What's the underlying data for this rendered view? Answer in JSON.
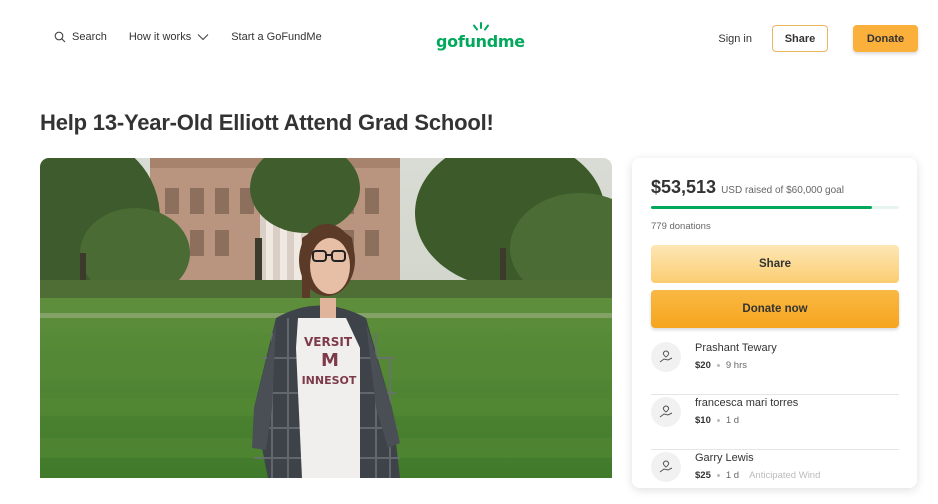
{
  "header": {
    "search_label": "Search",
    "how_it_works_label": "How it works",
    "start_label": "Start a GoFundMe",
    "logo_text": "gofundme",
    "signin_label": "Sign in",
    "share_label": "Share",
    "donate_label": "Donate"
  },
  "campaign": {
    "title": "Help 13-Year-Old Elliott Attend Grad School!"
  },
  "card": {
    "amount_raised": "$53,513",
    "raised_sub": "USD raised of $60,000 goal",
    "progress_fraction": 0.892,
    "donations_count": "779 donations",
    "share_label": "Share",
    "donate_label": "Donate now"
  },
  "donors": [
    {
      "name": "Prashant Tewary",
      "amount": "$20",
      "time": "9 hrs",
      "badge": ""
    },
    {
      "name": "francesca mari torres",
      "amount": "$10",
      "time": "1 d",
      "badge": ""
    },
    {
      "name": "Garry Lewis",
      "amount": "$25",
      "time": "1 d",
      "badge": "Anticipated Wind"
    }
  ],
  "colors": {
    "brand_green": "#02a95c",
    "donate_orange": "#fbb03b",
    "share_light": "#fde7b5"
  },
  "icons": {
    "search": "search-icon",
    "chevron": "chevron-down-icon",
    "donor": "donor-hand-heart-icon"
  }
}
